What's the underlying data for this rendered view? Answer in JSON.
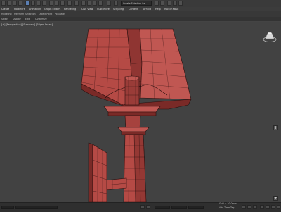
{
  "toolbar": {
    "selection_set": "Create Selection Se"
  },
  "menu": {
    "items": [
      "Create",
      "Modifiers",
      "Animation",
      "Graph Editors",
      "Rendering",
      "Civil View",
      "Customize",
      "Scripting",
      "Content",
      "Arnold",
      "Help",
      "MASSFXBSE"
    ]
  },
  "ribbon": {
    "items": [
      "Modeling",
      "Freeform",
      "Selection",
      "Object Paint",
      "Populate"
    ]
  },
  "tabs": {
    "items": [
      "Select",
      "Display",
      "Edit",
      "Customize"
    ]
  },
  "viewport": {
    "label": "[+] [Perspective] [Standard] [Edged Faces]"
  },
  "status": {
    "grid": "Grid = 10.0mm",
    "add_time_tag": "Add Time Tag"
  },
  "colors": {
    "mesh_fill": "#b54a45",
    "mesh_shadow": "#7a2a27",
    "mesh_highlight": "#cf625c",
    "wire": "#2a0f0e",
    "viewport_bg": "#424242"
  }
}
